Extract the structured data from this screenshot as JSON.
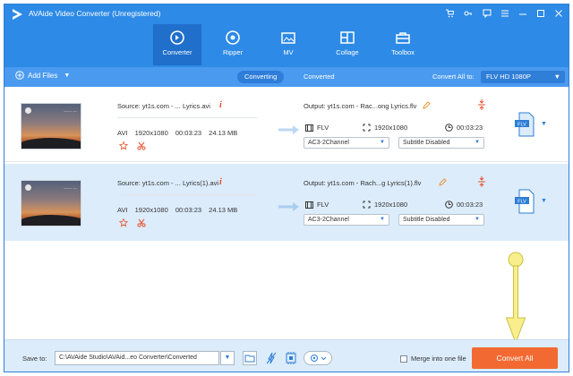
{
  "app": {
    "title": "AVAide Video Converter (Unregistered)",
    "accent": "#2d8ae6",
    "window_controls": [
      "cart-icon",
      "key-icon",
      "feedback-icon",
      "menu-icon",
      "minimize-icon",
      "maximize-icon",
      "close-icon"
    ]
  },
  "nav": {
    "tabs": [
      {
        "label": "Converter",
        "icon": "converter-icon",
        "active": true
      },
      {
        "label": "Ripper",
        "icon": "ripper-icon"
      },
      {
        "label": "MV",
        "icon": "mv-icon"
      },
      {
        "label": "Collage",
        "icon": "collage-icon"
      },
      {
        "label": "Toolbox",
        "icon": "toolbox-icon"
      }
    ]
  },
  "toolbar": {
    "add_files": "Add Files",
    "subtabs": [
      {
        "label": "Converting",
        "active": true
      },
      {
        "label": "Converted"
      }
    ],
    "convert_all_label": "Convert All to:",
    "convert_all_format": "FLV HD 1080P"
  },
  "files": [
    {
      "source": "Source: yt1s.com - ... Lyrics.avi",
      "format": "AVI",
      "resolution": "1920x1080",
      "duration": "00:03:23",
      "size": "24.13 MB",
      "output": "Output: yt1s.com - Rac...ong Lyrics.flv",
      "out_format": "FLV",
      "out_resolution": "1920x1080",
      "out_duration": "00:03:23",
      "audio": "AC3-2Channel",
      "subtitle": "Subtitle Disabled",
      "format_icon_label": "FLV"
    },
    {
      "source": "Source: yt1s.com - ... Lyrics(1).avi",
      "format": "AVI",
      "resolution": "1920x1080",
      "duration": "00:03:23",
      "size": "24.13 MB",
      "output": "Output: yt1s.com - Rach...g Lyrics(1).flv",
      "out_format": "FLV",
      "out_resolution": "1920x1080",
      "out_duration": "00:03:23",
      "audio": "AC3-2Channel",
      "subtitle": "Subtitle Disabled",
      "format_icon_label": "FLV"
    }
  ],
  "bottom": {
    "save_to_label": "Save to:",
    "save_path": "C:\\AVAide Studio\\AVAid...eo Converter\\Converted",
    "merge_label": "Merge into one file",
    "convert_button": "Convert All",
    "convert_color": "#f26a32"
  }
}
